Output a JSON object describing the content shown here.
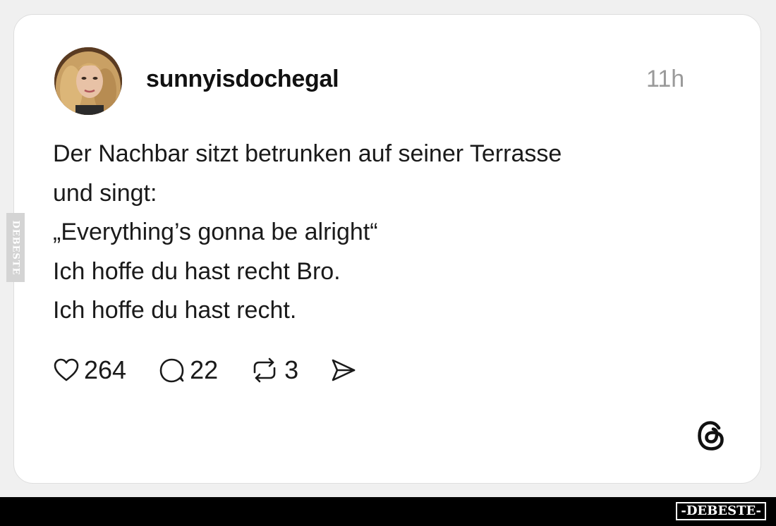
{
  "post": {
    "username": "sunnyisdochegal",
    "timestamp": "11h",
    "text_lines": [
      "Der Nachbar sitzt betrunken auf seiner Terrasse",
      "und singt:",
      "„Everything’s gonna be alright“",
      "Ich hoffe du hast recht Bro.",
      "Ich hoffe du hast recht."
    ],
    "actions": {
      "likes": "264",
      "replies": "22",
      "reposts": "3"
    }
  },
  "icons": {
    "avatar": "profile-photo",
    "like": "heart-icon",
    "reply": "speech-bubble-icon",
    "repost": "repost-arrows-icon",
    "share": "send-icon",
    "brand": "threads-logo-icon"
  },
  "watermarks": {
    "side": "DEBESTE",
    "bottom": "-DEBESTE-"
  },
  "colors": {
    "background": "#f0f0f0",
    "card": "#ffffff",
    "text": "#1a1a1a",
    "timestamp": "#9a9a9a",
    "bottom_bar": "#000000"
  }
}
